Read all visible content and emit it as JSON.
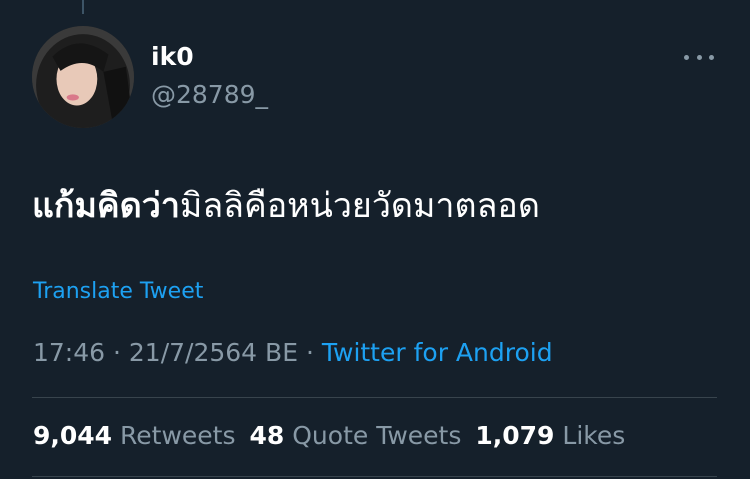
{
  "tweet": {
    "display_name": "ik0",
    "handle": "@28789_",
    "text_bold": "แก้มคิดว่า",
    "text_rest": "มิลลิคือหน่วยวัดมาตลอด",
    "translate_label": "Translate Tweet",
    "time": "17:46",
    "separator": "·",
    "date": "21/7/2564 BE",
    "source": "Twitter for Android"
  },
  "stats": {
    "retweets_count": "9,044",
    "retweets_label": "Retweets",
    "quotes_count": "48",
    "quotes_label": "Quote Tweets",
    "likes_count": "1,079",
    "likes_label": "Likes"
  },
  "icons": {
    "more": "more-horizontal-icon",
    "avatar": "user-avatar"
  },
  "colors": {
    "background": "#15202b",
    "link": "#1da1f2",
    "muted": "#8899a6",
    "divider": "#38444d"
  }
}
